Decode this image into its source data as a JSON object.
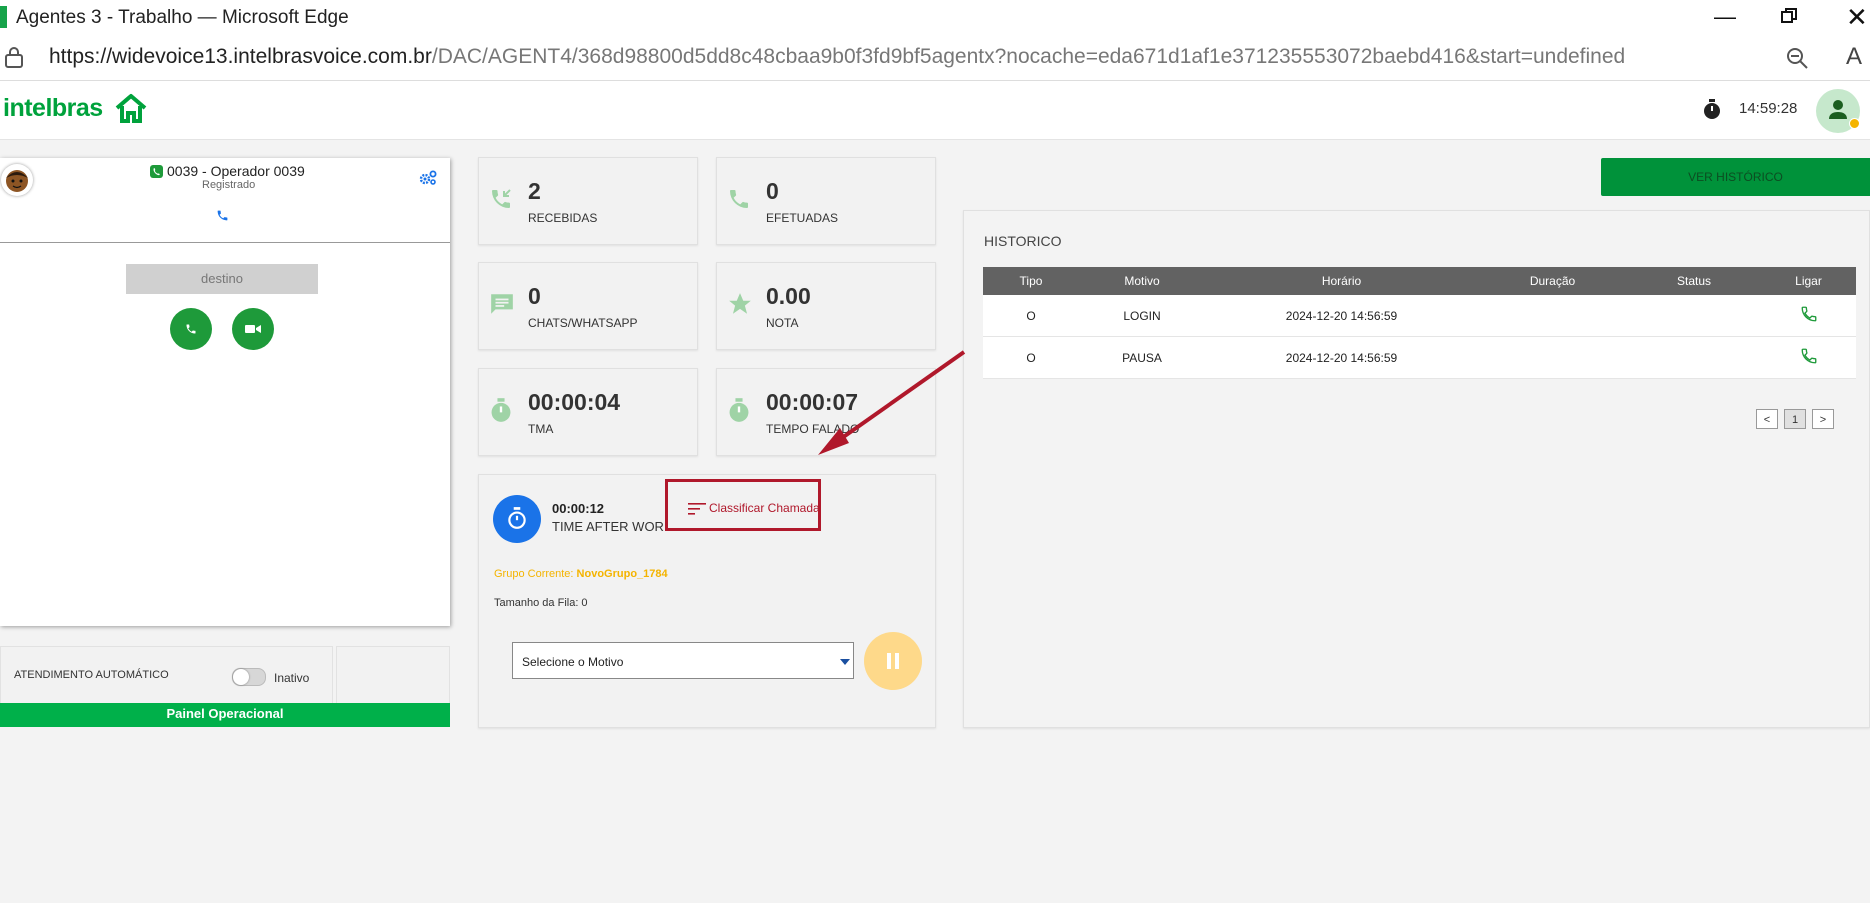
{
  "browser": {
    "window_title": "Agentes 3 - Trabalho — Microsoft Edge",
    "url_host": "https://widevoice13.intelbrasvoice.com.br",
    "url_path": "/DAC/AGENT4/368d98800d5dd8c48cbaa9b0f3fd9bf5agentx?nocache=eda671d1af1e371235553072baebd416&start=undefined",
    "read_aloud": "A"
  },
  "header": {
    "logo": "intelbras",
    "clock": "14:59:28"
  },
  "colors": {
    "brand_green": "#00a23c",
    "accent_red": "#b0182b",
    "blue": "#1a73e8"
  },
  "softphone": {
    "operator": "0039 - Operador 0039",
    "status": "Registrado",
    "destino_placeholder": "destino"
  },
  "auto_answer": {
    "label": "ATENDIMENTO AUTOMÁTICO",
    "state": "Inativo"
  },
  "panel_footer": "Painel Operacional",
  "stats": [
    {
      "value": "2",
      "label": "RECEBIDAS",
      "icon": "incoming-call-icon"
    },
    {
      "value": "0",
      "label": "EFETUADAS",
      "icon": "phone-icon"
    },
    {
      "value": "0",
      "label": "CHATS/WHATSAPP",
      "icon": "chat-icon"
    },
    {
      "value": "0.00",
      "label": "NOTA",
      "icon": "star-icon"
    },
    {
      "value": "00:00:04",
      "label": "TMA",
      "icon": "stopwatch-icon"
    },
    {
      "value": "00:00:07",
      "label": "TEMPO FALADO",
      "icon": "stopwatch-icon"
    }
  ],
  "status_panel": {
    "timer": "00:00:12",
    "state": "TIME AFTER WORK",
    "classify_button": "Classificar Chamada",
    "group_label": "Grupo Corrente:",
    "group_value": "NovoGrupo_1784",
    "queue": "Tamanho da Fila: 0",
    "motivo_select": "Selecione o Motivo"
  },
  "history": {
    "button": "VER HISTÓRICO",
    "title": "HISTORICO",
    "columns": [
      "Tipo",
      "Motivo",
      "Horário",
      "Duração",
      "Status",
      "Ligar"
    ],
    "rows": [
      {
        "tipo": "O",
        "motivo": "LOGIN",
        "horario": "2024-12-20 14:56:59",
        "duracao": "",
        "status": ""
      },
      {
        "tipo": "O",
        "motivo": "PAUSA",
        "horario": "2024-12-20 14:56:59",
        "duracao": "",
        "status": ""
      }
    ],
    "pagination": {
      "prev": "<",
      "page": "1",
      "next": ">"
    }
  }
}
